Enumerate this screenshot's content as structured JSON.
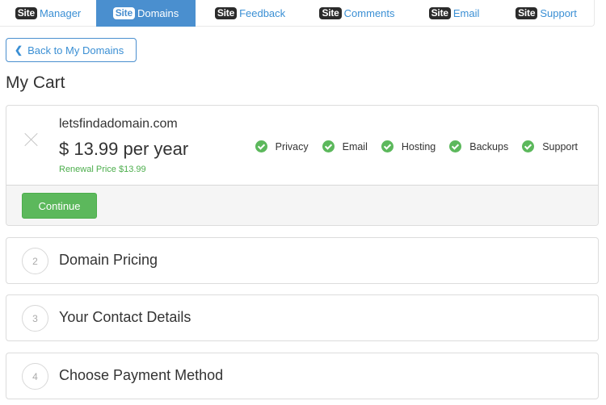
{
  "nav": {
    "badge": "Site",
    "items": [
      {
        "label": "Manager",
        "active": false
      },
      {
        "label": "Domains",
        "active": true
      },
      {
        "label": "Feedback",
        "active": false
      },
      {
        "label": "Comments",
        "active": false
      },
      {
        "label": "Email",
        "active": false
      },
      {
        "label": "Support",
        "active": false
      }
    ]
  },
  "back_button": {
    "icon": "chevron-left-icon",
    "glyph": "❮",
    "label": "Back to My Domains"
  },
  "page_title": "My Cart",
  "cart": {
    "domain": "letsfindadomain.com",
    "price": "$ 13.99 per year",
    "renewal": "Renewal Price $13.99",
    "features": [
      "Privacy",
      "Email",
      "Hosting",
      "Backups",
      "Support"
    ],
    "continue_label": "Continue"
  },
  "steps": [
    {
      "number": "2",
      "label": "Domain Pricing"
    },
    {
      "number": "3",
      "label": "Your Contact Details"
    },
    {
      "number": "4",
      "label": "Choose Payment Method"
    }
  ],
  "colors": {
    "accent": "#4a8fcf",
    "success": "#5cb85c",
    "link": "#3a8fd4"
  }
}
